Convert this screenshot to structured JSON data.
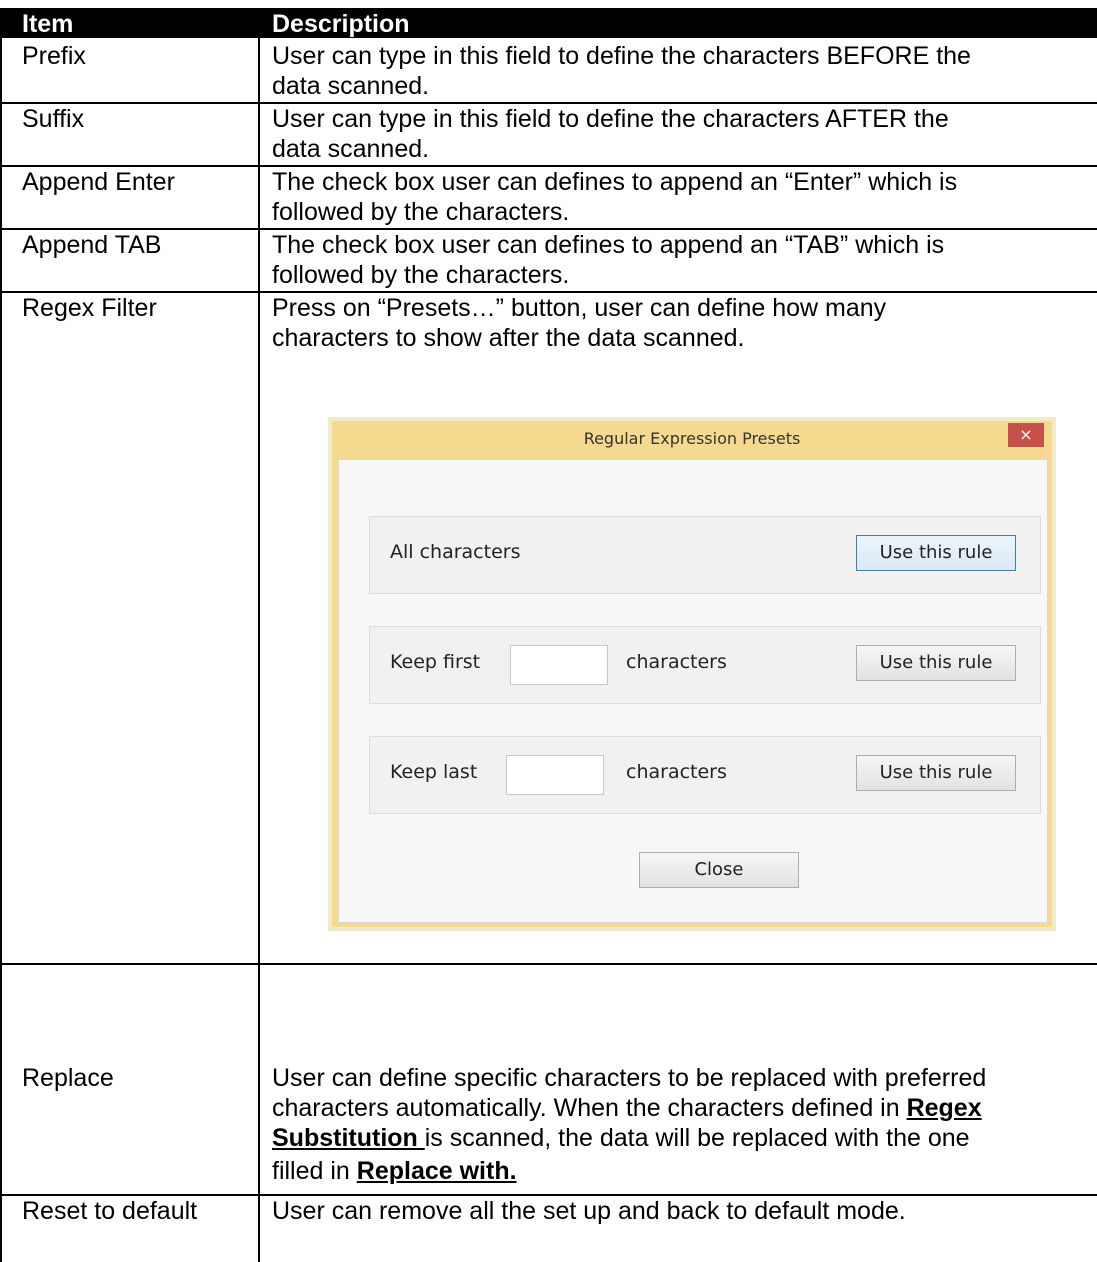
{
  "table": {
    "header": {
      "item": "Item",
      "description": "Description"
    },
    "rows": [
      {
        "item": "Prefix",
        "line1": "User can type in this field to define the characters BEFORE the",
        "line2": "data scanned."
      },
      {
        "item": "Suffix",
        "line1": "User can type in this field to define the characters AFTER the",
        "line2": "data scanned."
      },
      {
        "item": "Append Enter",
        "line1": "The check box user can defines to append an “Enter” which is",
        "line2": "followed by the characters."
      },
      {
        "item": "Append TAB",
        "line1": "The check box user can defines to append an “TAB” which is",
        "line2": "followed by the characters."
      },
      {
        "item": "Regex Filter",
        "line1": "Press on “Presets…” button, user can define how many",
        "line2": "characters to show after the data scanned."
      },
      {
        "item": "Replace",
        "line1": "User can define specific characters to be replaced with preferred",
        "line2_a": "characters automatically. When the characters defined in ",
        "line2_b": "Regex",
        "line3_a": "Substitution ",
        "line3_b": "is scanned, the data will be replaced with the one",
        "line4_a": "filled in ",
        "line4_b": "Replace with."
      },
      {
        "item": "Reset to default",
        "line1": "User can remove all the set up and back to default mode."
      }
    ]
  },
  "dialog": {
    "title": "Regular Expression Presets",
    "close_glyph": "×",
    "rules": [
      {
        "label": "All characters",
        "button": "Use this rule"
      },
      {
        "label": "Keep first",
        "suffix": "characters",
        "input_value": "",
        "button": "Use this rule"
      },
      {
        "label": "Keep last",
        "suffix": "characters",
        "input_value": "",
        "button": "Use this rule"
      }
    ],
    "close_button": "Close"
  }
}
